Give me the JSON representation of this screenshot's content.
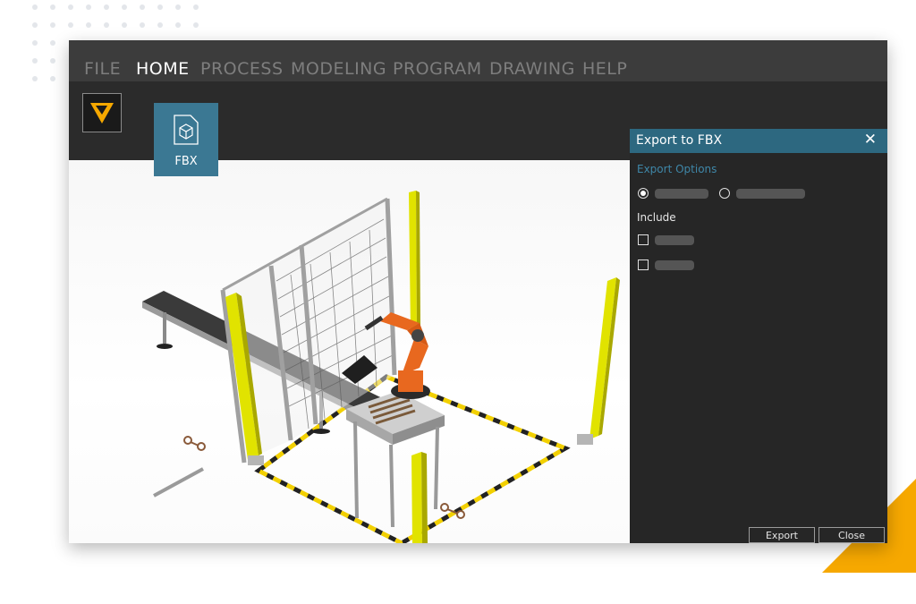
{
  "menu": {
    "items": [
      {
        "label": "FILE"
      },
      {
        "label": "HOME"
      },
      {
        "label": "PROCESS"
      },
      {
        "label": "MODELING"
      },
      {
        "label": "PROGRAM"
      },
      {
        "label": "DRAWING"
      },
      {
        "label": "HELP"
      }
    ],
    "active": "HOME"
  },
  "ribbon": {
    "fbx_button_label": "FBX",
    "fbx_icon": "cube-icon",
    "logo_icon": "app-logo-icon"
  },
  "export_panel": {
    "title": "Export to FBX",
    "close_icon": "close-icon",
    "export_options_label": "Export Options",
    "radio_selected_index": 0,
    "include_label": "Include",
    "checkboxes_checked": [
      false,
      false
    ],
    "export_button": "Export",
    "close_button": "Close"
  },
  "colors": {
    "accent": "#2d6880",
    "accent_text": "#3f87a8",
    "brand_yellow": "#f6a800",
    "robot_orange": "#e8681f",
    "panel_bg": "#262626",
    "menubar_bg": "#3c3c3c"
  }
}
